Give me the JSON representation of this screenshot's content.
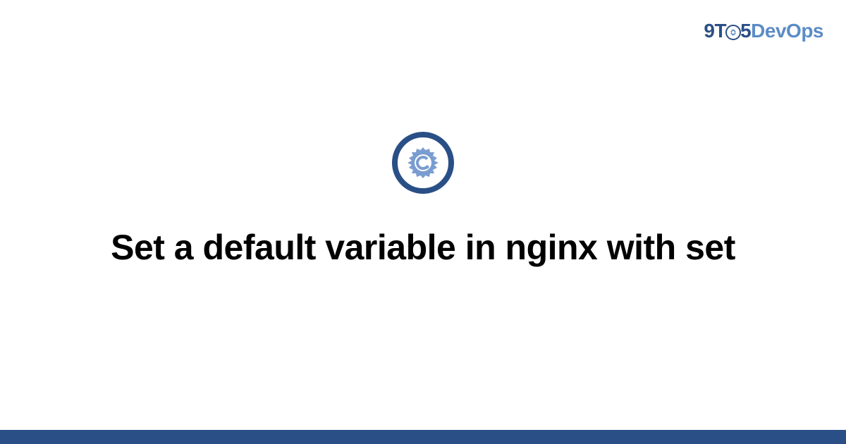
{
  "logo": {
    "part1": "9T",
    "part2": "5",
    "part3": "DevOps"
  },
  "title": "Set a default variable in nginx with set",
  "colors": {
    "primary": "#2a4f87",
    "secondary": "#5b8cc6",
    "iconStroke": "#2a4f87",
    "iconFill": "#7a9dd0"
  }
}
